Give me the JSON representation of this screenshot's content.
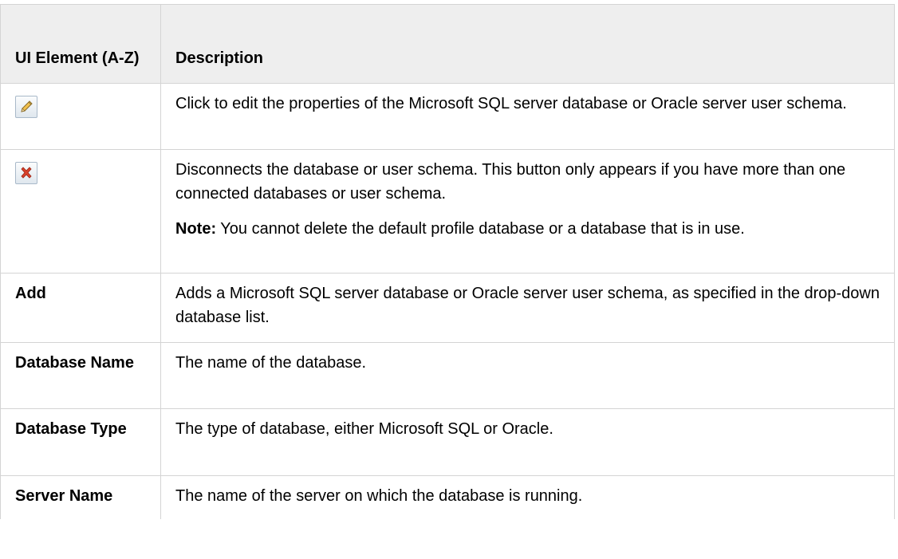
{
  "header": {
    "col1": "UI Element (A-Z)",
    "col2": "Description"
  },
  "rows": [
    {
      "icon": "pencil-edit-icon",
      "description": "Click to edit the properties of the Microsoft SQL server database or Oracle server user schema."
    },
    {
      "icon": "red-x-delete-icon",
      "description": "Disconnects the database or user schema. This button only appears if you have more than one connected databases or user schema.",
      "note_label": "Note:",
      "note_text": " You cannot delete the default profile database or a database that is in use."
    },
    {
      "name": "Add",
      "description": "Adds a Microsoft SQL server database or Oracle server user schema, as specified in the drop-down database list."
    },
    {
      "name": "Database Name",
      "description": "The name of the database."
    },
    {
      "name": "Database Type",
      "description": "The type of database, either Microsoft SQL or Oracle."
    },
    {
      "name": "Server Name",
      "description": "The name of the server on which the database is running."
    }
  ],
  "colors": {
    "header_bg": "#eeeeee",
    "border": "#d4d4d4",
    "delete_icon": "#d9412b",
    "edit_icon": "#f2c14e"
  }
}
